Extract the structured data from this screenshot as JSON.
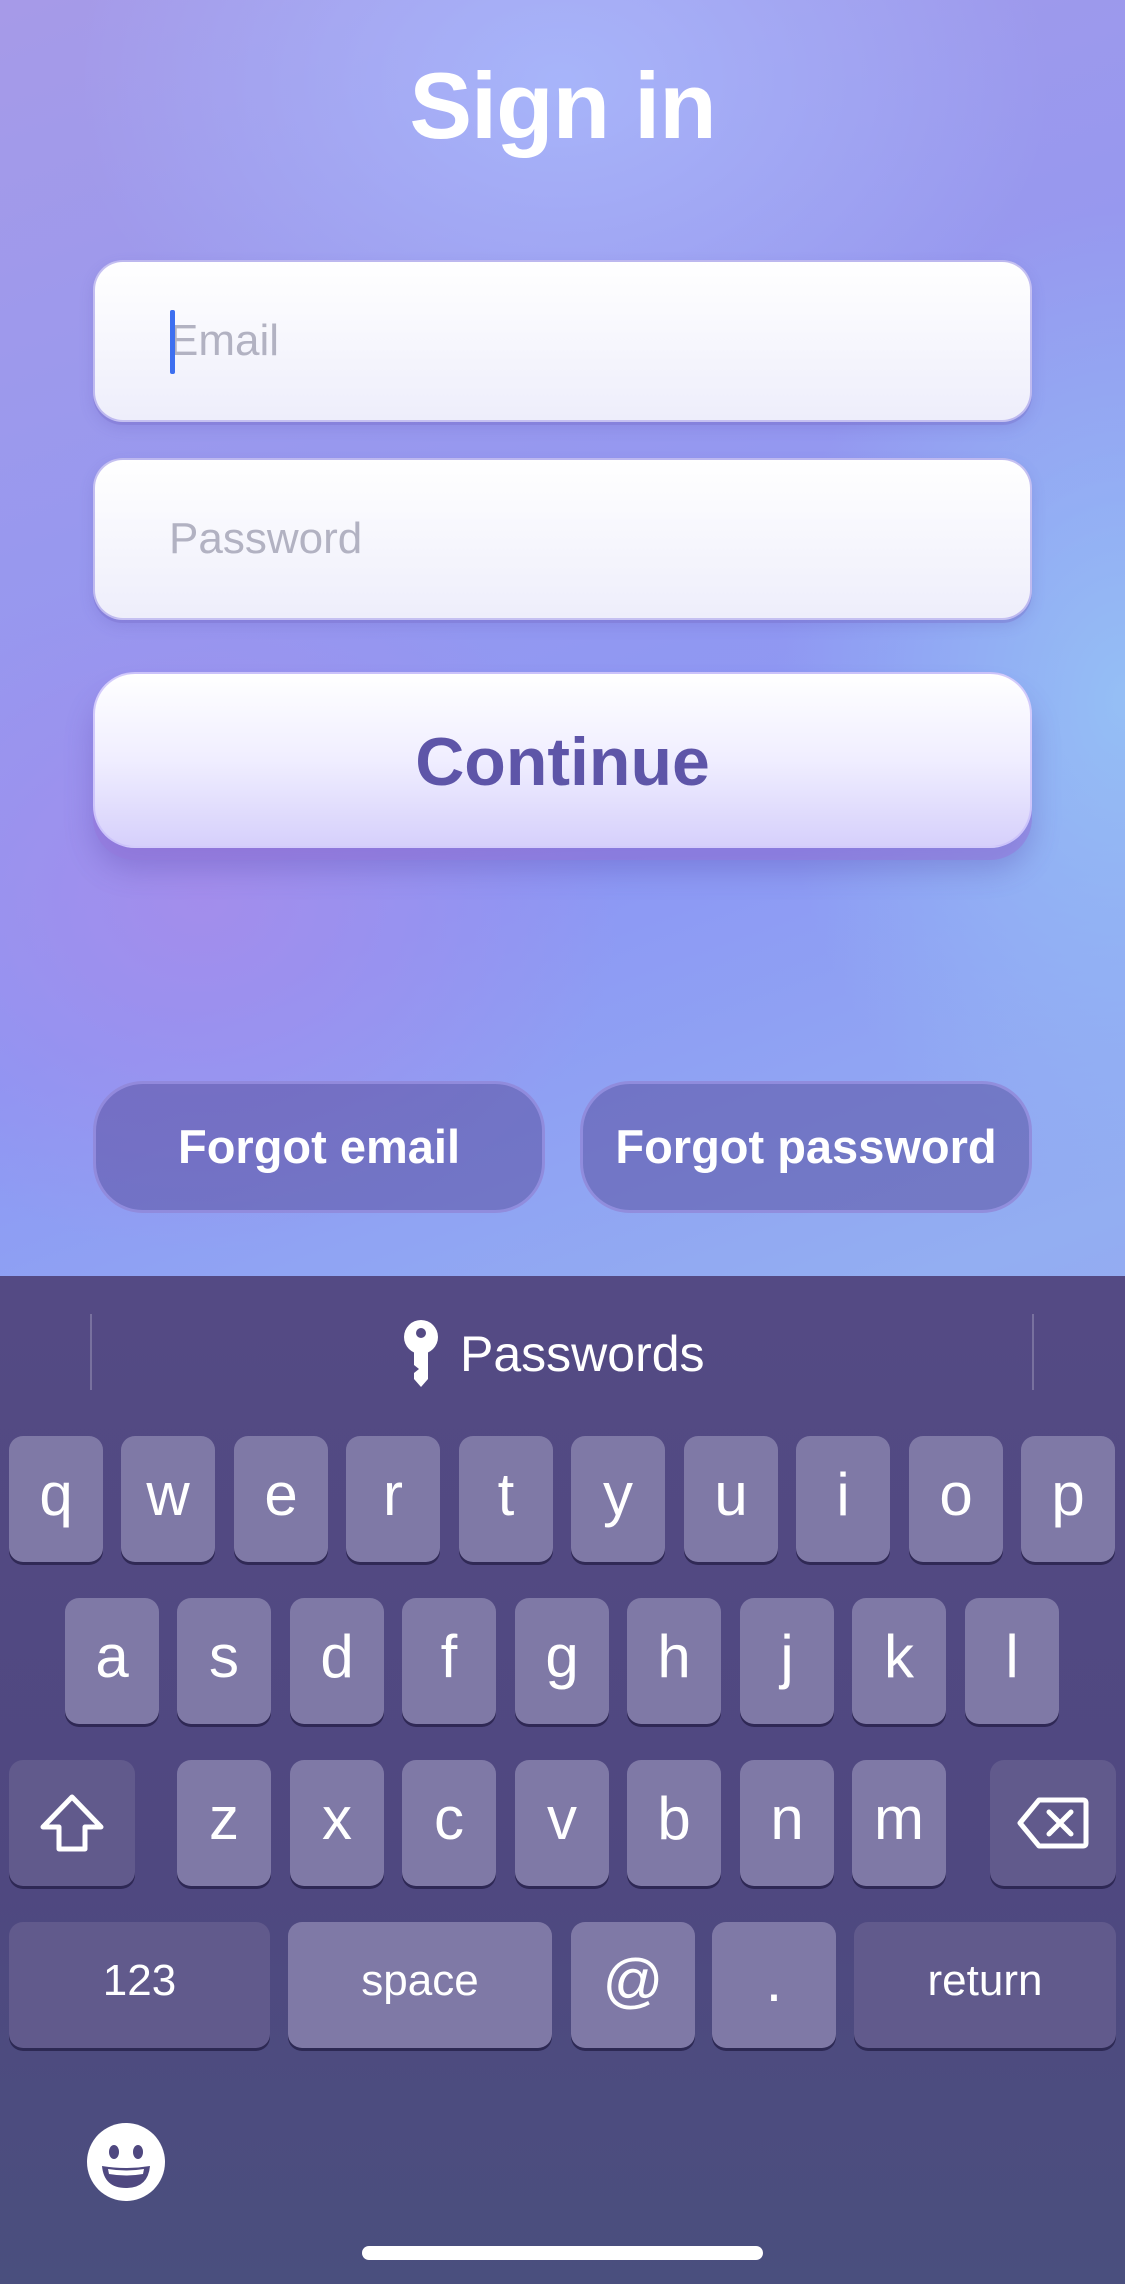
{
  "screen_title": "Sign in",
  "email_field": {
    "placeholder": "Email",
    "value": ""
  },
  "password_field": {
    "placeholder": "Password",
    "value": ""
  },
  "continue_label": "Continue",
  "links": {
    "forgot_email": "Forgot email",
    "forgot_password": "Forgot password"
  },
  "keyboard": {
    "suggestion_label": "Passwords",
    "row1": [
      "q",
      "w",
      "e",
      "r",
      "t",
      "y",
      "u",
      "i",
      "o",
      "p"
    ],
    "row2": [
      "a",
      "s",
      "d",
      "f",
      "g",
      "h",
      "j",
      "k",
      "l"
    ],
    "row3": [
      "z",
      "x",
      "c",
      "v",
      "b",
      "n",
      "m"
    ],
    "numbers_key": "123",
    "space_key": "space",
    "at_key": "@",
    "period_key": ".",
    "return_key": "return",
    "icons": [
      "key-icon",
      "shift-icon",
      "delete-icon",
      "emoji-icon"
    ]
  }
}
